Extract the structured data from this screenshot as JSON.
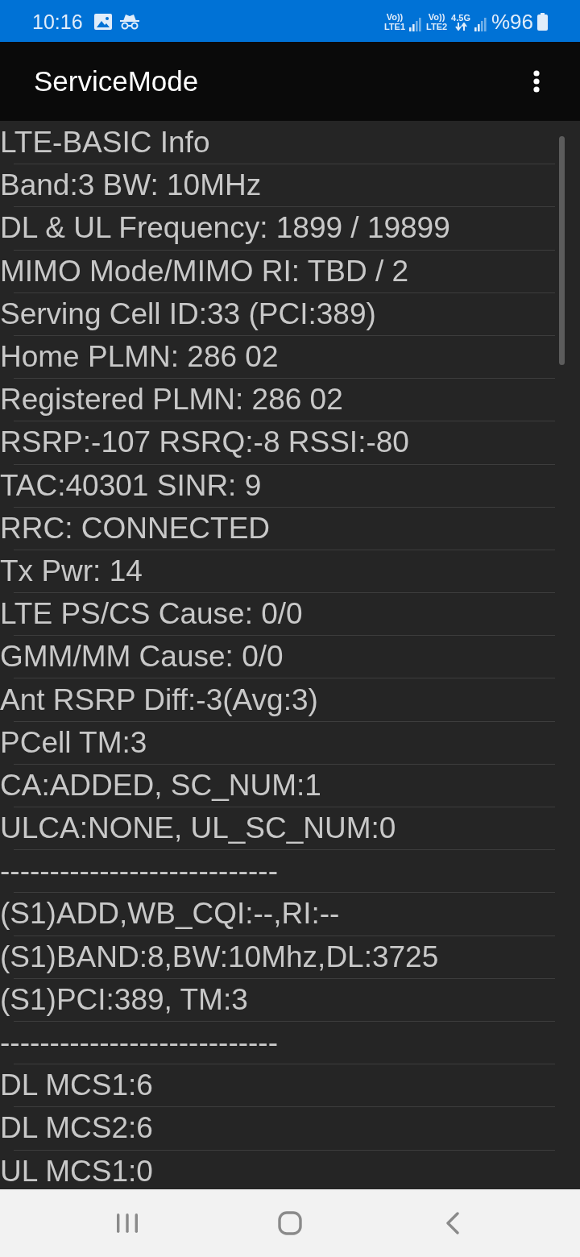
{
  "status_bar": {
    "time": "10:16",
    "sims": [
      {
        "volte": "Vo))",
        "label": "LTE1"
      },
      {
        "volte": "Vo))",
        "label": "LTE2",
        "network": "4.5G"
      }
    ],
    "battery": "%96"
  },
  "app_bar": {
    "title": "ServiceMode"
  },
  "info_lines": [
    "LTE-BASIC Info",
    "Band:3 BW: 10MHz",
    "DL & UL Frequency: 1899 / 19899",
    "MIMO Mode/MIMO RI: TBD / 2",
    "Serving Cell ID:33 (PCI:389)",
    "Home PLMN: 286 02",
    "Registered PLMN: 286 02",
    "RSRP:-107 RSRQ:-8 RSSI:-80",
    "TAC:40301 SINR: 9",
    "RRC: CONNECTED",
    "Tx Pwr: 14",
    "LTE PS/CS Cause: 0/0",
    "GMM/MM Cause: 0/0",
    "Ant RSRP Diff:-3(Avg:3)",
    "PCell TM:3",
    "CA:ADDED, SC_NUM:1",
    "ULCA:NONE, UL_SC_NUM:0",
    "----------------------------",
    "(S1)ADD,WB_CQI:--,RI:--",
    "(S1)BAND:8,BW:10Mhz,DL:3725",
    "(S1)PCI:389, TM:3",
    "----------------------------",
    "DL MCS1:6",
    "DL MCS2:6",
    "UL MCS1:0"
  ]
}
